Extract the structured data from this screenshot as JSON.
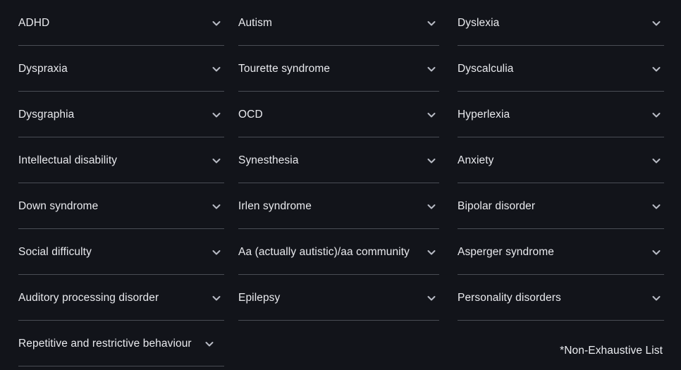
{
  "theme": {
    "background": "#12141a",
    "text_color": "#e9eaee",
    "divider_color": "#4a4d55",
    "chevron_color": "#b9bcc6"
  },
  "footnote": "*Non-Exhaustive List",
  "icons": {
    "expand": "chevron-down-icon"
  },
  "columns": [
    {
      "id": "column-1",
      "items": [
        {
          "label": "ADHD"
        },
        {
          "label": "Dyspraxia"
        },
        {
          "label": "Dysgraphia"
        },
        {
          "label": "Intellectual disability"
        },
        {
          "label": "Down syndrome"
        },
        {
          "label": "Social difficulty"
        },
        {
          "label": "Auditory processing disorder"
        },
        {
          "label": "Repetitive and restrictive behaviour"
        }
      ]
    },
    {
      "id": "column-2",
      "items": [
        {
          "label": "Autism"
        },
        {
          "label": "Tourette syndrome"
        },
        {
          "label": "OCD"
        },
        {
          "label": "Synesthesia"
        },
        {
          "label": "Irlen syndrome"
        },
        {
          "label": "Aa (actually autistic)/aa community"
        },
        {
          "label": "Epilepsy"
        }
      ]
    },
    {
      "id": "column-3",
      "items": [
        {
          "label": "Dyslexia"
        },
        {
          "label": "Dyscalculia"
        },
        {
          "label": "Hyperlexia"
        },
        {
          "label": "Anxiety"
        },
        {
          "label": "Bipolar disorder"
        },
        {
          "label": "Asperger syndrome"
        },
        {
          "label": "Personality disorders"
        }
      ]
    }
  ]
}
